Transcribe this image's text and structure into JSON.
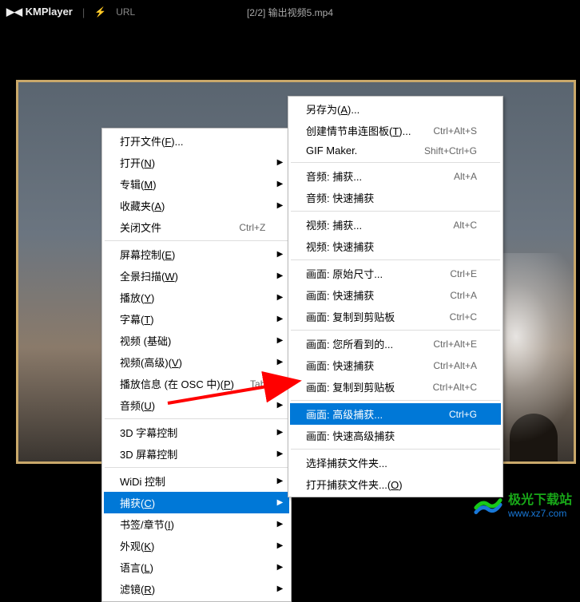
{
  "titlebar": {
    "app_name": "KMPlayer",
    "url_label": "URL",
    "playing": "[2/2] 输出视频5.mp4"
  },
  "menu1": {
    "items": [
      {
        "label": "打开文件(<u>F</u>)...",
        "arrow": false
      },
      {
        "label": "打开(<u>N</u>)",
        "arrow": true
      },
      {
        "label": "专辑(<u>M</u>)",
        "arrow": true
      },
      {
        "label": "收藏夹(<u>A</u>)",
        "arrow": true
      },
      {
        "label": "关闭文件",
        "shortcut": "Ctrl+Z",
        "arrow": false
      }
    ],
    "items2": [
      {
        "label": "屏幕控制(<u>E</u>)",
        "arrow": true
      },
      {
        "label": "全景扫描(<u>W</u>)",
        "arrow": true
      },
      {
        "label": "播放(<u>Y</u>)",
        "arrow": true
      },
      {
        "label": "字幕(<u>T</u>)",
        "arrow": true
      },
      {
        "label": "视频 (基础)",
        "arrow": true
      },
      {
        "label": "视频(高级)(<u>V</u>)",
        "arrow": true
      },
      {
        "label": "播放信息 (在 OSC 中)(<u>P</u>)",
        "shortcut": "Tab",
        "arrow": false
      },
      {
        "label": "音频(<u>U</u>)",
        "arrow": true
      }
    ],
    "items3": [
      {
        "label": "3D 字幕控制",
        "arrow": true
      },
      {
        "label": "3D 屏幕控制",
        "arrow": true
      }
    ],
    "items4": [
      {
        "label": "WiDi 控制",
        "arrow": true
      },
      {
        "label": "捕获(<u>C</u>)",
        "arrow": true,
        "highlighted": true
      },
      {
        "label": "书签/章节(<u>I</u>)",
        "arrow": true
      },
      {
        "label": "外观(<u>K</u>)",
        "arrow": true
      },
      {
        "label": "语言(<u>L</u>)",
        "arrow": true
      },
      {
        "label": "滤镜(<u>R</u>)",
        "arrow": true
      }
    ]
  },
  "menu2": {
    "g1": [
      {
        "label": "另存为(<u>A</u>)..."
      },
      {
        "label": "创建情节串连图板(<u>T</u>)...",
        "shortcut": "Ctrl+Alt+S"
      },
      {
        "label": "GIF Maker.",
        "shortcut": "Shift+Ctrl+G"
      }
    ],
    "g2": [
      {
        "label": "音频: 捕获...",
        "shortcut": "Alt+A"
      },
      {
        "label": "音频: 快速捕获"
      }
    ],
    "g3": [
      {
        "label": "视频: 捕获...",
        "shortcut": "Alt+C"
      },
      {
        "label": "视频: 快速捕获"
      }
    ],
    "g4": [
      {
        "label": "画面: 原始尺寸...",
        "shortcut": "Ctrl+E"
      },
      {
        "label": "画面: 快速捕获",
        "shortcut": "Ctrl+A"
      },
      {
        "label": "画面: 复制到剪贴板",
        "shortcut": "Ctrl+C"
      }
    ],
    "g5": [
      {
        "label": "画面: 您所看到的...",
        "shortcut": "Ctrl+Alt+E"
      },
      {
        "label": "画面: 快速捕获",
        "shortcut": "Ctrl+Alt+A"
      },
      {
        "label": "画面: 复制到剪贴板",
        "shortcut": "Ctrl+Alt+C"
      }
    ],
    "g6": [
      {
        "label": "画面: 高级捕获...",
        "shortcut": "Ctrl+G",
        "highlighted": true
      },
      {
        "label": "画面: 快速高级捕获"
      }
    ],
    "g7": [
      {
        "label": "选择捕获文件夹..."
      },
      {
        "label": "打开捕获文件夹...(<u>O</u>)"
      }
    ]
  },
  "watermark": {
    "cn": "极光下载站",
    "url": "www.xz7.com"
  }
}
